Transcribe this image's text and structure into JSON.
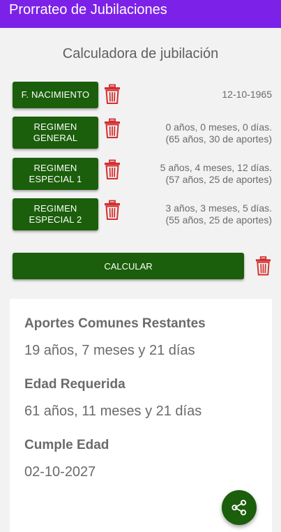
{
  "app": {
    "title": "Prorrateo de Jubilaciones"
  },
  "screen": {
    "title": "Calculadora de jubilación"
  },
  "rows": [
    {
      "button_label": "F. NACIMIENTO",
      "info_line1": "12-10-1965",
      "info_line2": ""
    },
    {
      "button_line1": "REGIMEN",
      "button_line2": "GENERAL",
      "info_line1": "0 años, 0 meses, 0 días.",
      "info_line2": "(65 años, 30 de aportes)"
    },
    {
      "button_line1": "REGIMEN",
      "button_line2": "ESPECIAL 1",
      "info_line1": "5 años, 4 meses, 12 días.",
      "info_line2": "(57 años, 25 de aportes)"
    },
    {
      "button_line1": "REGIMEN",
      "button_line2": "ESPECIAL 2",
      "info_line1": "3 años, 3 meses, 5 días.",
      "info_line2": "(55 años, 25 de aportes)"
    }
  ],
  "calculate": {
    "label": "CALCULAR"
  },
  "results": {
    "aportes_label": "Aportes Comunes Restantes",
    "aportes_value": "19 años, 7 meses y 21 días",
    "edad_label": "Edad Requerida",
    "edad_value": "61 años, 11 meses y 21 días",
    "cumple_label": "Cumple Edad",
    "cumple_value": "02-10-2027"
  },
  "icons": {
    "delete": "trash-icon",
    "share": "share-icon"
  },
  "colors": {
    "appbar": "#7c22e8",
    "button": "#1b5e0b",
    "delete": "#d32f2f"
  }
}
